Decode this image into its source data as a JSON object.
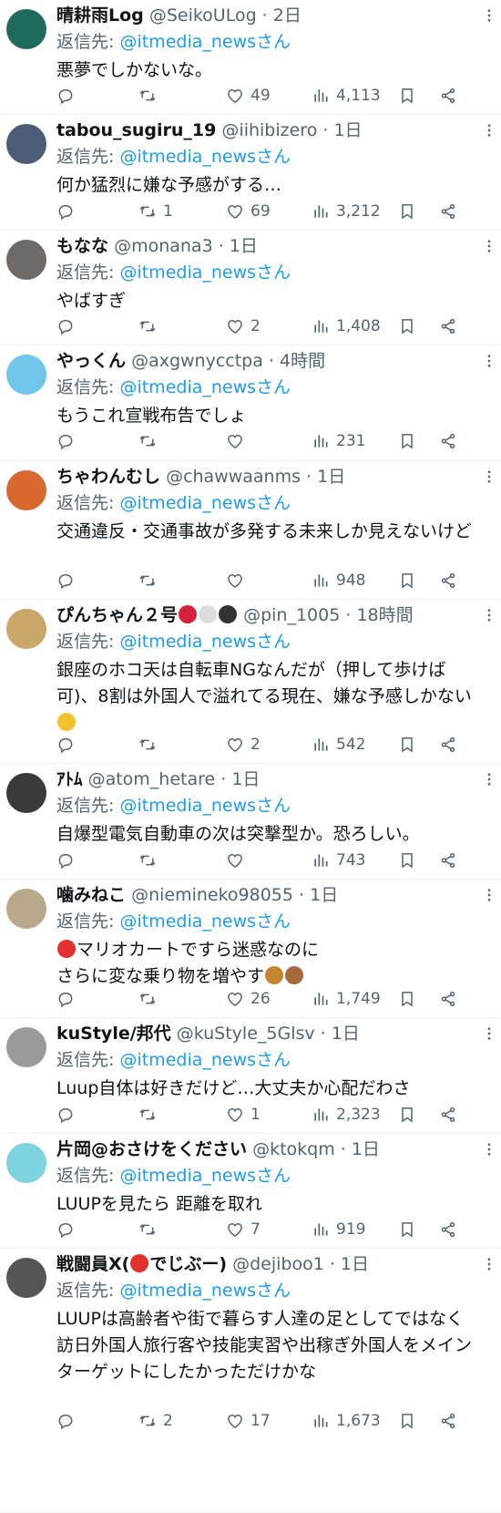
{
  "reply_prefix": "返信先: ",
  "reply_suffix": "さん",
  "colors": {
    "accent": "#1d9bf0",
    "secondary": "#536471",
    "divider": "#eff3f4"
  },
  "icons": [
    "reply-icon",
    "retweet-icon",
    "like-icon",
    "views-icon",
    "bookmark-icon",
    "share-icon",
    "more-icon"
  ],
  "tweets": [
    {
      "name": "晴耕雨Log",
      "handle": "@SeikoULog",
      "time": "2日",
      "mention": "@itmedia_news",
      "text": "悪夢でしかないな。",
      "replies": "",
      "retweets": "",
      "likes": "49",
      "views": "4,113",
      "avatar_color": "#1f6a5a"
    },
    {
      "name": "tabou_sugiru_19",
      "handle": "@iihibizero",
      "time": "1日",
      "mention": "@itmedia_news",
      "text": "何か猛烈に嫌な予感がする…",
      "replies": "",
      "retweets": "1",
      "likes": "69",
      "views": "3,212",
      "avatar_color": "#4b5d77"
    },
    {
      "name": "もなな",
      "handle": "@monana3",
      "time": "1日",
      "mention": "@itmedia_news",
      "text": "やばすぎ",
      "replies": "",
      "retweets": "",
      "likes": "2",
      "views": "1,408",
      "avatar_color": "#6e6a68"
    },
    {
      "name": "やっくん",
      "handle": "@axgwnycctpa",
      "time": "4時間",
      "mention": "@itmedia_news",
      "text": "もうこれ宣戦布告でしょ",
      "replies": "",
      "retweets": "",
      "likes": "",
      "views": "231",
      "avatar_color": "#6fc6e8"
    },
    {
      "name": "ちゃわんむし",
      "handle": "@chawwaanms",
      "time": "1日",
      "mention": "@itmedia_news",
      "text": "交通違反・交通事故が多発する未来しか見えないけど",
      "replies": "",
      "retweets": "",
      "likes": "",
      "views": "948",
      "avatar_color": "#d9682f"
    },
    {
      "name": "ぴんちゃん２号",
      "name_emoji": [
        "cherry",
        "rabbit",
        "panda"
      ],
      "handle": "@pin_1005",
      "time": "18時間",
      "mention": "@itmedia_news",
      "text": "銀座のホコ天は自転車NGなんだが（押して歩けば可)、8割は外国人で溢れてる現在、嫌な予感しかない",
      "text_emoji": "persevering-face",
      "replies": "",
      "retweets": "",
      "likes": "2",
      "views": "542",
      "avatar_color": "#c9a76a"
    },
    {
      "name": "ｱﾄﾑ",
      "handle": "@atom_hetare",
      "time": "1日",
      "mention": "@itmedia_news",
      "text": "自爆型電気自動車の次は突撃型か。恐ろしい。",
      "replies": "",
      "retweets": "",
      "likes": "",
      "views": "743",
      "avatar_color": "#3a3a3a"
    },
    {
      "name": "噛みねこ",
      "handle": "@niemineko98055",
      "time": "1日",
      "mention": "@itmedia_news",
      "text_emoji_before": "car",
      "text": "マリオカートですら迷惑なのに\nさらに変な乗り物を増やす",
      "text_emoji": "horse deer",
      "replies": "",
      "retweets": "",
      "likes": "26",
      "views": "1,749",
      "avatar_color": "#b9a889"
    },
    {
      "name": "kuStyle/邦代",
      "handle": "@kuStyle_5Glsv",
      "time": "1日",
      "mention": "@itmedia_news",
      "text": "Luup自体は好きだけど…大丈夫か心配だわさ",
      "replies": "",
      "retweets": "",
      "likes": "1",
      "views": "2,323",
      "avatar_color": "#9a9a9a"
    },
    {
      "name": "片岡@おさけをください",
      "handle": "@ktokqm",
      "time": "1日",
      "mention": "@itmedia_news",
      "text": "LUUPを見たら 距離を取れ",
      "replies": "",
      "retweets": "",
      "likes": "7",
      "views": "919",
      "avatar_color": "#7fd3e0"
    },
    {
      "name": "戦闘員X(",
      "name_after": "でじぶー)",
      "name_emoji": [
        "no-entry"
      ],
      "handle": "@dejiboo1",
      "time": "1日",
      "mention": "@itmedia_news",
      "text": "LUUPは高齢者や街で暮らす人達の足としてではなく\n訪日外国人旅行客や技能実習や出稼ぎ外国人をメインターゲットにしたかっただけかな",
      "replies": "",
      "retweets": "2",
      "likes": "17",
      "views": "1,673",
      "avatar_color": "#555555"
    }
  ]
}
